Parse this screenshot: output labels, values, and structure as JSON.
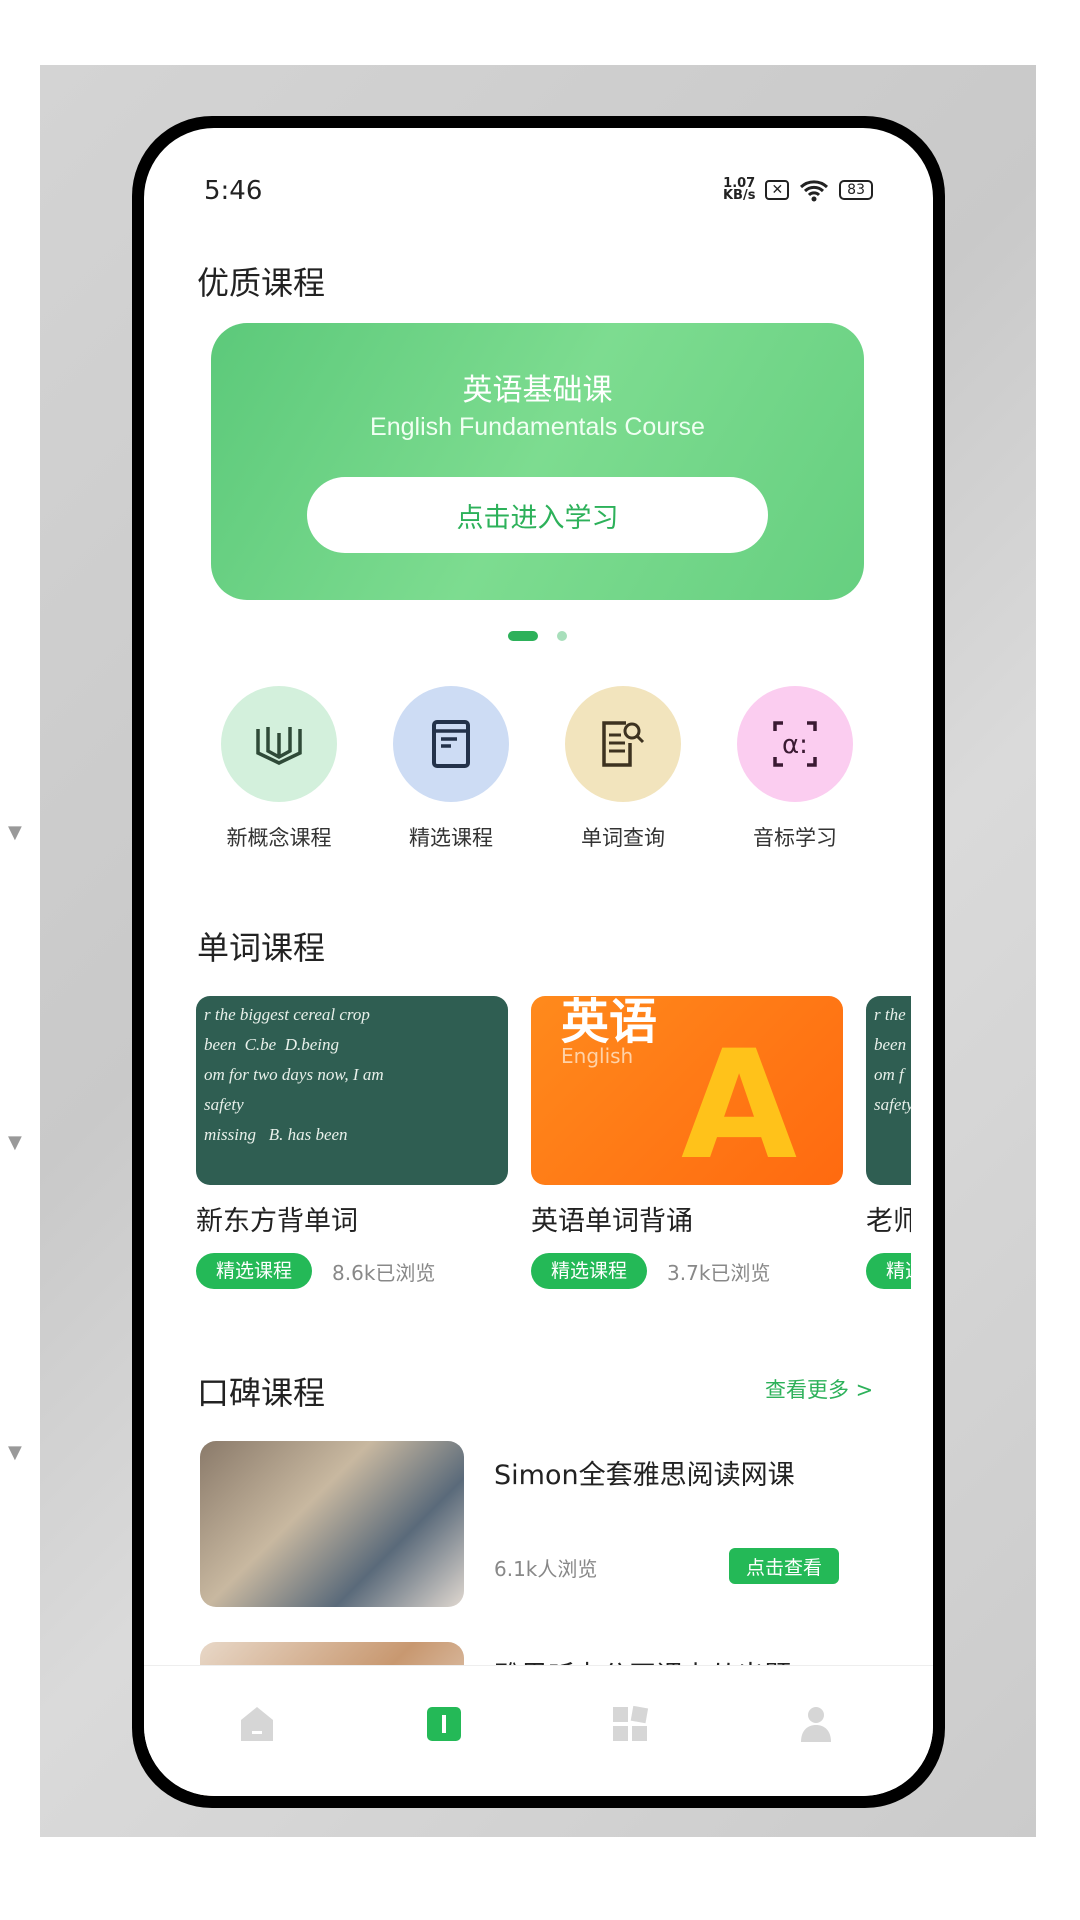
{
  "status_bar": {
    "time": "5:46",
    "net_speed_top": "1.07",
    "net_speed_unit": "KB/s",
    "battery": "83"
  },
  "featured": {
    "title": "优质课程",
    "banner": {
      "title": "英语基础课",
      "subtitle": "English Fundamentals Course",
      "button": "点击进入学习"
    },
    "carousel": {
      "count": 2,
      "active": 0
    }
  },
  "categories": [
    {
      "label": "新概念课程",
      "icon": "open-book-icon",
      "color": "#d3f0dc"
    },
    {
      "label": "精选课程",
      "icon": "book-icon",
      "color": "#cddcf4"
    },
    {
      "label": "单词查询",
      "icon": "document-search-icon",
      "color": "#f2e4bd"
    },
    {
      "label": "音标学习",
      "icon": "phonetic-icon",
      "color": "#fbcdf0"
    }
  ],
  "word_courses": {
    "title": "单词课程",
    "items": [
      {
        "title": "新东方背单词",
        "tag": "精选课程",
        "views": "8.6k已浏览"
      },
      {
        "title": "英语单词背诵",
        "tag": "精选课程",
        "views": "3.7k已浏览",
        "image_text": "英语",
        "image_sub": "English"
      },
      {
        "title": "老师",
        "tag": "精选课程",
        "views": ""
      }
    ]
  },
  "popular": {
    "title": "口碑课程",
    "more": "查看更多 >",
    "items": [
      {
        "title": "Simon全套雅思阅读网课",
        "views": "6.1k人浏览",
        "button": "点击查看"
      },
      {
        "title": "雅思听力公开课上从出题"
      }
    ]
  },
  "nav": {
    "items": [
      "home-icon",
      "course-icon",
      "apps-icon",
      "profile-icon"
    ],
    "active": 1,
    "accent": "#24b957",
    "inactive": "#d6d6d6"
  }
}
